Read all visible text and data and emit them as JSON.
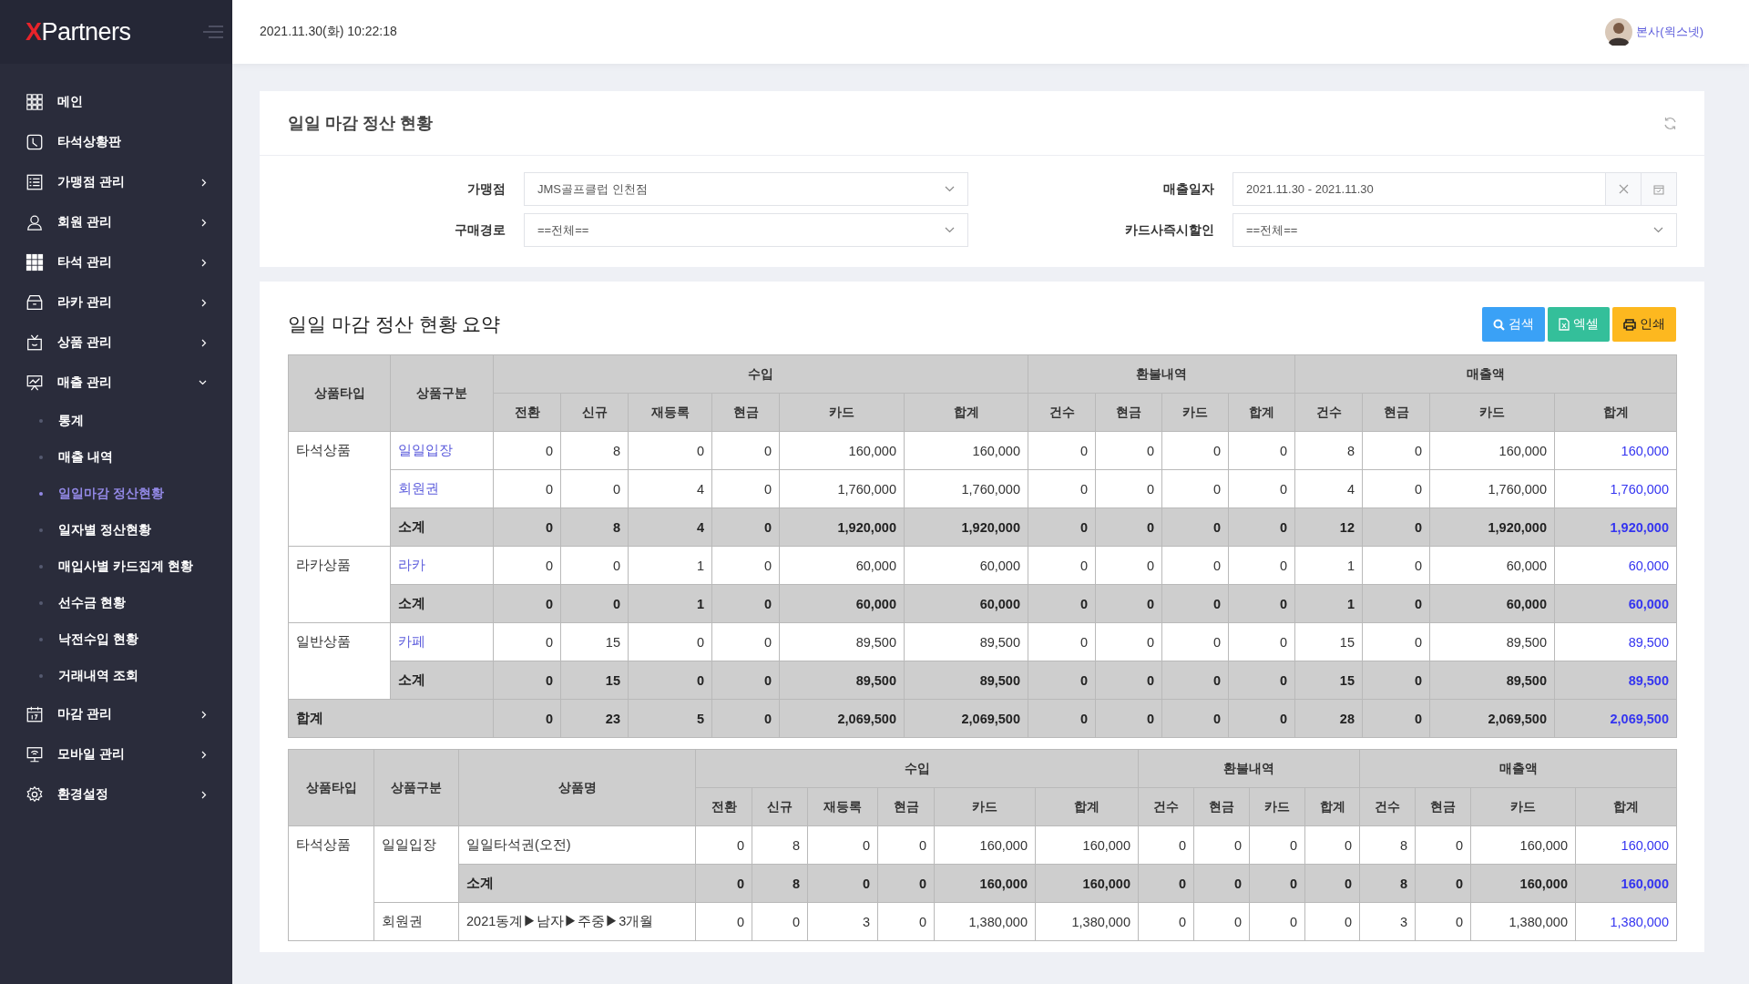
{
  "sidebar": {
    "logo_mark": "X",
    "logo_text": "Partners",
    "items": [
      {
        "label": "메인"
      },
      {
        "label": "타석상황판"
      },
      {
        "label": "가맹점 관리",
        "expanded": false
      },
      {
        "label": "회원 관리",
        "expanded": false
      },
      {
        "label": "타석 관리",
        "expanded": false
      },
      {
        "label": "라카 관리",
        "expanded": false
      },
      {
        "label": "상품 관리",
        "expanded": false
      },
      {
        "label": "매출 관리",
        "expanded": true,
        "children": [
          {
            "label": "통계",
            "selected": false
          },
          {
            "label": "매출 내역",
            "selected": false
          },
          {
            "label": "일일마감 정산현황",
            "selected": true
          },
          {
            "label": "일자별 정산현황",
            "selected": false
          },
          {
            "label": "매입사별 카드집계 현황",
            "selected": false
          },
          {
            "label": "선수금 현황",
            "selected": false
          },
          {
            "label": "낙전수입 현황",
            "selected": false
          },
          {
            "label": "거래내역 조회",
            "selected": false
          }
        ]
      },
      {
        "label": "마감 관리",
        "expanded": false
      },
      {
        "label": "모바일 관리",
        "expanded": false
      },
      {
        "label": "환경설정",
        "expanded": false
      }
    ]
  },
  "header": {
    "datetime": "2021.11.30(화) 10:22:18",
    "user": "본사(윅스넷)"
  },
  "filter": {
    "title": "일일 마감 정산 현황",
    "fields": [
      {
        "label": "가맹점",
        "kind": "select",
        "value": "JMS골프클럽 인천점"
      },
      {
        "label": "매출일자",
        "kind": "daterange",
        "value": "2021.11.30 - 2021.11.30"
      },
      {
        "label": "구매경로",
        "kind": "select",
        "value": "==전체=="
      },
      {
        "label": "카드사즉시할인",
        "kind": "select",
        "value": "==전체=="
      }
    ]
  },
  "summary": {
    "title": "일일 마감 정산 현황 요약",
    "buttons": [
      {
        "label": "검색",
        "kind": "search"
      },
      {
        "label": "엑셀",
        "kind": "excel"
      },
      {
        "label": "인쇄",
        "kind": "print"
      }
    ],
    "table": {
      "fixed_columns": [
        "상품타입",
        "상품구분"
      ],
      "groups": [
        {
          "label": "수입",
          "columns": [
            "전환",
            "신규",
            "재등록",
            "현금",
            "카드",
            "합계"
          ]
        },
        {
          "label": "환불내역",
          "columns": [
            "건수",
            "현금",
            "카드",
            "합계"
          ]
        },
        {
          "label": "매출액",
          "columns": [
            "건수",
            "현금",
            "카드",
            "합계"
          ]
        }
      ],
      "sections": [
        {
          "type": "타석상품",
          "rows": [
            {
              "kind": "item",
              "category": "일일입장",
              "values": [
                "0",
                "8",
                "0",
                "0",
                "160,000",
                "160,000",
                "0",
                "0",
                "0",
                "0",
                "8",
                "0",
                "160,000",
                "160,000"
              ]
            },
            {
              "kind": "item",
              "category": "회원권",
              "values": [
                "0",
                "0",
                "4",
                "0",
                "1,760,000",
                "1,760,000",
                "0",
                "0",
                "0",
                "0",
                "4",
                "0",
                "1,760,000",
                "1,760,000"
              ]
            },
            {
              "kind": "subtotal",
              "category": "소계",
              "values": [
                "0",
                "8",
                "4",
                "0",
                "1,920,000",
                "1,920,000",
                "0",
                "0",
                "0",
                "0",
                "12",
                "0",
                "1,920,000",
                "1,920,000"
              ]
            }
          ]
        },
        {
          "type": "라카상품",
          "rows": [
            {
              "kind": "item",
              "category": "라카",
              "values": [
                "0",
                "0",
                "1",
                "0",
                "60,000",
                "60,000",
                "0",
                "0",
                "0",
                "0",
                "1",
                "0",
                "60,000",
                "60,000"
              ]
            },
            {
              "kind": "subtotal",
              "category": "소계",
              "values": [
                "0",
                "0",
                "1",
                "0",
                "60,000",
                "60,000",
                "0",
                "0",
                "0",
                "0",
                "1",
                "0",
                "60,000",
                "60,000"
              ]
            }
          ]
        },
        {
          "type": "일반상품",
          "rows": [
            {
              "kind": "item",
              "category": "카페",
              "values": [
                "0",
                "15",
                "0",
                "0",
                "89,500",
                "89,500",
                "0",
                "0",
                "0",
                "0",
                "15",
                "0",
                "89,500",
                "89,500"
              ]
            },
            {
              "kind": "subtotal",
              "category": "소계",
              "values": [
                "0",
                "15",
                "0",
                "0",
                "89,500",
                "89,500",
                "0",
                "0",
                "0",
                "0",
                "15",
                "0",
                "89,500",
                "89,500"
              ]
            }
          ]
        }
      ],
      "total": {
        "label": "합계",
        "values": [
          "0",
          "23",
          "5",
          "0",
          "2,069,500",
          "2,069,500",
          "0",
          "0",
          "0",
          "0",
          "28",
          "0",
          "2,069,500",
          "2,069,500"
        ]
      }
    }
  },
  "detail": {
    "fixed_columns": [
      "상품타입",
      "상품구분",
      "상품명"
    ],
    "groups": [
      {
        "label": "수입",
        "columns": [
          "전환",
          "신규",
          "재등록",
          "현금",
          "카드",
          "합계"
        ]
      },
      {
        "label": "환불내역",
        "columns": [
          "건수",
          "현금",
          "카드",
          "합계"
        ]
      },
      {
        "label": "매출액",
        "columns": [
          "건수",
          "현금",
          "카드",
          "합계"
        ]
      }
    ],
    "sections": [
      {
        "type": "타석상품",
        "categories": [
          {
            "name": "일일입장",
            "items": [
              {
                "name": "일일타석권(오전)",
                "values": [
                  "0",
                  "8",
                  "0",
                  "0",
                  "160,000",
                  "160,000",
                  "0",
                  "0",
                  "0",
                  "0",
                  "8",
                  "0",
                  "160,000",
                  "160,000"
                ]
              }
            ],
            "subtotal": {
              "label": "소계",
              "values": [
                "0",
                "8",
                "0",
                "0",
                "160,000",
                "160,000",
                "0",
                "0",
                "0",
                "0",
                "8",
                "0",
                "160,000",
                "160,000"
              ]
            }
          },
          {
            "name": "회원권",
            "items": [
              {
                "name": "2021동계▶남자▶주중▶3개월",
                "values": [
                  "0",
                  "0",
                  "3",
                  "0",
                  "1,380,000",
                  "1,380,000",
                  "0",
                  "0",
                  "0",
                  "0",
                  "3",
                  "0",
                  "1,380,000",
                  "1,380,000"
                ]
              }
            ]
          }
        ]
      }
    ]
  }
}
